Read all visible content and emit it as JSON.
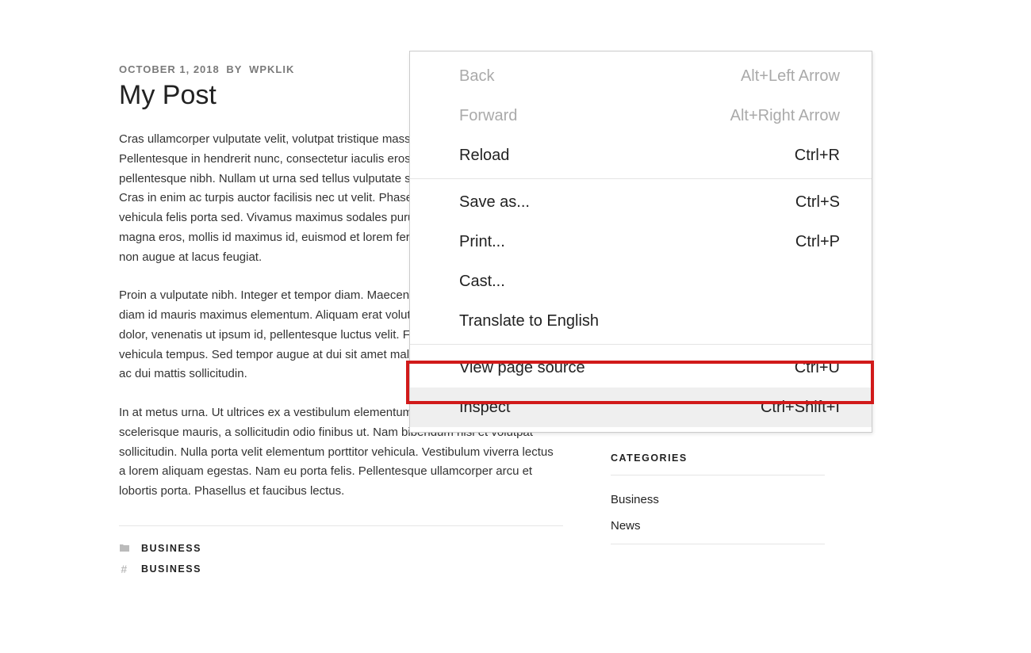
{
  "post": {
    "date": "OCTOBER 1, 2018",
    "by_label": "BY",
    "author": "WPKLIK",
    "title": "My Post",
    "para1": "Cras ullamcorper vulputate velit, volutpat tristique massa porttitor sit amet. Pellentesque in hendrerit nunc, consectetur iaculis eros. Vivamus lobortis pellentesque nibh. Nullam ut urna sed tellus vulputate sodales. Vestibulum et odio. Cras in enim ac turpis auctor facilisis nec ut velit. Phasellus pulvinar felis risus, nec vehicula felis porta sed. Vivamus maximus sodales purus, eu diam at tristique. Nulla magna eros, mollis id maximus id, euismod et lorem fermentum quis nisl. Praesent non augue at lacus feugiat.",
    "para2": "Proin a vulputate nibh. Integer et tempor diam. Maecenas laoreet nulla sit amet diam id mauris maximus elementum. Aliquam erat volutpat. Suspendisse ligula dolor, venenatis ut ipsum id, pellentesque luctus velit. Fusce non lacus eu mauris vehicula tempus. Sed tempor augue at dui sit amet malesuada. Maecenas et massa ac dui mattis sollicitudin.",
    "para3": "In at metus urna. Ut ultrices ex a vestibulum elementum. Vivamus tempus scelerisque mauris, a sollicitudin odio finibus ut. Nam bibendum nisi et volutpat sollicitudin. Nulla porta velit elementum porttitor vehicula. Vestibulum viverra lectus a lorem aliquam egestas. Nam eu porta felis. Pellentesque ullamcorper arcu et lobortis porta. Phasellus et faucibus lectus."
  },
  "footer": {
    "category_label": "BUSINESS",
    "tag_label": "BUSINESS"
  },
  "sidebar": {
    "heading": "CATEGORIES",
    "items": [
      "Business",
      "News"
    ]
  },
  "context_menu": {
    "items": [
      {
        "label": "Back",
        "shortcut": "Alt+Left Arrow",
        "disabled": true
      },
      {
        "label": "Forward",
        "shortcut": "Alt+Right Arrow",
        "disabled": true
      },
      {
        "label": "Reload",
        "shortcut": "Ctrl+R",
        "disabled": false
      },
      {
        "sep": true
      },
      {
        "label": "Save as...",
        "shortcut": "Ctrl+S",
        "disabled": false
      },
      {
        "label": "Print...",
        "shortcut": "Ctrl+P",
        "disabled": false
      },
      {
        "label": "Cast...",
        "shortcut": "",
        "disabled": false
      },
      {
        "label": "Translate to English",
        "shortcut": "",
        "disabled": false
      },
      {
        "sep": true
      },
      {
        "label": "View page source",
        "shortcut": "Ctrl+U",
        "disabled": false
      },
      {
        "label": "Inspect",
        "shortcut": "Ctrl+Shift+I",
        "disabled": false,
        "highlighted": true
      }
    ]
  }
}
